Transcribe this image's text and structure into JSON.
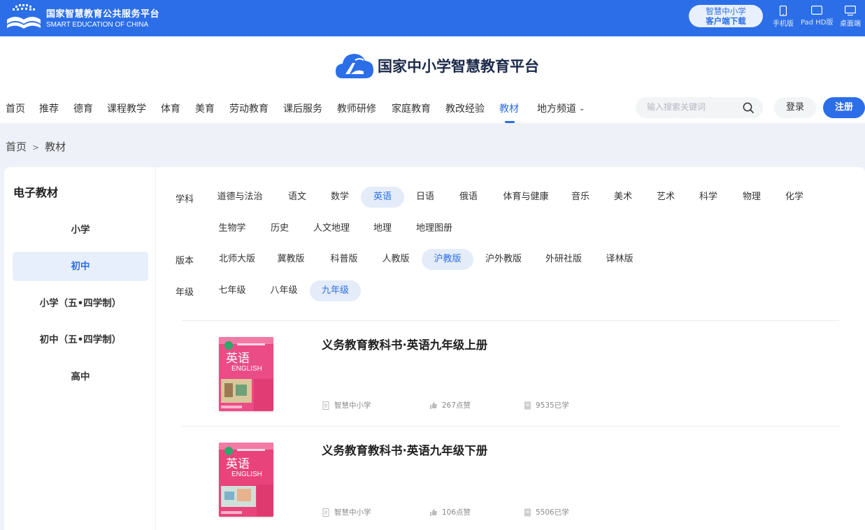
{
  "topbar": {
    "brand_cn": "国家智慧教育公共服务平台",
    "brand_en": "SMART EDUCATION OF CHINA",
    "download_line1": "智慧中小学",
    "download_line2": "客户端下载",
    "devices": [
      {
        "label": "手机版",
        "icon": "phone-icon"
      },
      {
        "label": "Pad HD版",
        "icon": "tablet-icon"
      },
      {
        "label": "桌面端",
        "icon": "desktop-icon"
      }
    ]
  },
  "header": {
    "title": "国家中小学智慧教育平台",
    "nav": [
      "首页",
      "推荐",
      "德育",
      "课程教学",
      "体育",
      "美育",
      "劳动教育",
      "课后服务",
      "教师研修",
      "家庭教育",
      "教改经验",
      "教材",
      "地方频道"
    ],
    "nav_active": "教材",
    "search_placeholder": "输入搜索关键词",
    "login": "登录",
    "register": "注册"
  },
  "breadcrumb": {
    "home": "首页",
    "sep": ">",
    "current": "教材"
  },
  "sidebar": {
    "title": "电子教材",
    "items": [
      "小学",
      "初中",
      "小学（五•四学制）",
      "初中（五•四学制）",
      "高中"
    ],
    "active": "初中"
  },
  "filters": {
    "subject_label": "学科",
    "subjects": [
      "道德与法治",
      "语文",
      "数学",
      "英语",
      "日语",
      "俄语",
      "体育与健康",
      "音乐",
      "美术",
      "艺术",
      "科学",
      "物理",
      "化学",
      "生物学",
      "历史",
      "人文地理",
      "地理",
      "地理图册"
    ],
    "subject_active": "英语",
    "edition_label": "版本",
    "editions": [
      "北师大版",
      "冀教版",
      "科普版",
      "人教版",
      "沪教版",
      "沪外教版",
      "外研社版",
      "译林版"
    ],
    "edition_active": "沪教版",
    "grade_label": "年级",
    "grades": [
      "七年级",
      "八年级",
      "九年级"
    ],
    "grade_active": "九年级"
  },
  "books": [
    {
      "title": "义务教育教科书·英语九年级上册",
      "publisher": "智慧中小学",
      "likes": "267点赞",
      "learned": "9535已学",
      "cover_text": "英语",
      "cover_en": "ENGLISH",
      "cover_color": "#e9457f"
    },
    {
      "title": "义务教育教科书·英语九年级下册",
      "publisher": "智慧中小学",
      "likes": "106点赞",
      "learned": "5506已学",
      "cover_text": "英语",
      "cover_en": "ENGLISH",
      "cover_color": "#e63f78"
    }
  ],
  "colors": {
    "primary": "#2b6ee8",
    "active_bg": "#e4ecfa",
    "page_bg": "#eef2f8"
  }
}
